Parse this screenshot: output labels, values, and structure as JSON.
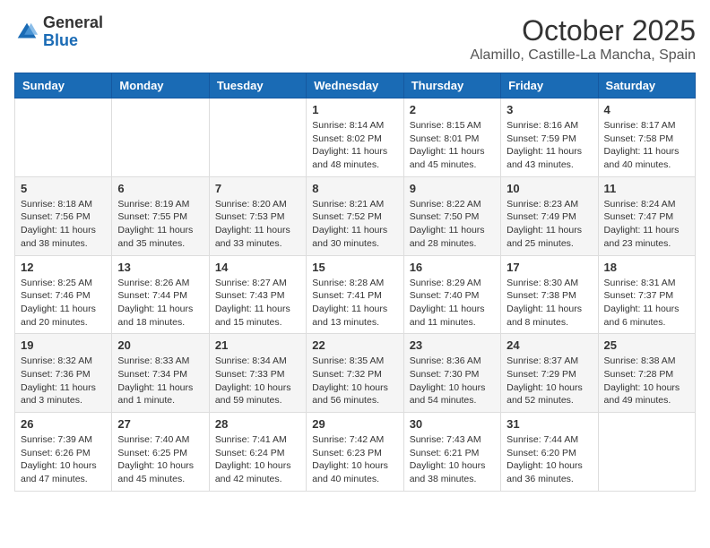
{
  "logo": {
    "general": "General",
    "blue": "Blue"
  },
  "title": "October 2025",
  "location": "Alamillo, Castille-La Mancha, Spain",
  "days_of_week": [
    "Sunday",
    "Monday",
    "Tuesday",
    "Wednesday",
    "Thursday",
    "Friday",
    "Saturday"
  ],
  "weeks": [
    [
      {
        "day": "",
        "info": ""
      },
      {
        "day": "",
        "info": ""
      },
      {
        "day": "",
        "info": ""
      },
      {
        "day": "1",
        "info": "Sunrise: 8:14 AM\nSunset: 8:02 PM\nDaylight: 11 hours and 48 minutes."
      },
      {
        "day": "2",
        "info": "Sunrise: 8:15 AM\nSunset: 8:01 PM\nDaylight: 11 hours and 45 minutes."
      },
      {
        "day": "3",
        "info": "Sunrise: 8:16 AM\nSunset: 7:59 PM\nDaylight: 11 hours and 43 minutes."
      },
      {
        "day": "4",
        "info": "Sunrise: 8:17 AM\nSunset: 7:58 PM\nDaylight: 11 hours and 40 minutes."
      }
    ],
    [
      {
        "day": "5",
        "info": "Sunrise: 8:18 AM\nSunset: 7:56 PM\nDaylight: 11 hours and 38 minutes."
      },
      {
        "day": "6",
        "info": "Sunrise: 8:19 AM\nSunset: 7:55 PM\nDaylight: 11 hours and 35 minutes."
      },
      {
        "day": "7",
        "info": "Sunrise: 8:20 AM\nSunset: 7:53 PM\nDaylight: 11 hours and 33 minutes."
      },
      {
        "day": "8",
        "info": "Sunrise: 8:21 AM\nSunset: 7:52 PM\nDaylight: 11 hours and 30 minutes."
      },
      {
        "day": "9",
        "info": "Sunrise: 8:22 AM\nSunset: 7:50 PM\nDaylight: 11 hours and 28 minutes."
      },
      {
        "day": "10",
        "info": "Sunrise: 8:23 AM\nSunset: 7:49 PM\nDaylight: 11 hours and 25 minutes."
      },
      {
        "day": "11",
        "info": "Sunrise: 8:24 AM\nSunset: 7:47 PM\nDaylight: 11 hours and 23 minutes."
      }
    ],
    [
      {
        "day": "12",
        "info": "Sunrise: 8:25 AM\nSunset: 7:46 PM\nDaylight: 11 hours and 20 minutes."
      },
      {
        "day": "13",
        "info": "Sunrise: 8:26 AM\nSunset: 7:44 PM\nDaylight: 11 hours and 18 minutes."
      },
      {
        "day": "14",
        "info": "Sunrise: 8:27 AM\nSunset: 7:43 PM\nDaylight: 11 hours and 15 minutes."
      },
      {
        "day": "15",
        "info": "Sunrise: 8:28 AM\nSunset: 7:41 PM\nDaylight: 11 hours and 13 minutes."
      },
      {
        "day": "16",
        "info": "Sunrise: 8:29 AM\nSunset: 7:40 PM\nDaylight: 11 hours and 11 minutes."
      },
      {
        "day": "17",
        "info": "Sunrise: 8:30 AM\nSunset: 7:38 PM\nDaylight: 11 hours and 8 minutes."
      },
      {
        "day": "18",
        "info": "Sunrise: 8:31 AM\nSunset: 7:37 PM\nDaylight: 11 hours and 6 minutes."
      }
    ],
    [
      {
        "day": "19",
        "info": "Sunrise: 8:32 AM\nSunset: 7:36 PM\nDaylight: 11 hours and 3 minutes."
      },
      {
        "day": "20",
        "info": "Sunrise: 8:33 AM\nSunset: 7:34 PM\nDaylight: 11 hours and 1 minute."
      },
      {
        "day": "21",
        "info": "Sunrise: 8:34 AM\nSunset: 7:33 PM\nDaylight: 10 hours and 59 minutes."
      },
      {
        "day": "22",
        "info": "Sunrise: 8:35 AM\nSunset: 7:32 PM\nDaylight: 10 hours and 56 minutes."
      },
      {
        "day": "23",
        "info": "Sunrise: 8:36 AM\nSunset: 7:30 PM\nDaylight: 10 hours and 54 minutes."
      },
      {
        "day": "24",
        "info": "Sunrise: 8:37 AM\nSunset: 7:29 PM\nDaylight: 10 hours and 52 minutes."
      },
      {
        "day": "25",
        "info": "Sunrise: 8:38 AM\nSunset: 7:28 PM\nDaylight: 10 hours and 49 minutes."
      }
    ],
    [
      {
        "day": "26",
        "info": "Sunrise: 7:39 AM\nSunset: 6:26 PM\nDaylight: 10 hours and 47 minutes."
      },
      {
        "day": "27",
        "info": "Sunrise: 7:40 AM\nSunset: 6:25 PM\nDaylight: 10 hours and 45 minutes."
      },
      {
        "day": "28",
        "info": "Sunrise: 7:41 AM\nSunset: 6:24 PM\nDaylight: 10 hours and 42 minutes."
      },
      {
        "day": "29",
        "info": "Sunrise: 7:42 AM\nSunset: 6:23 PM\nDaylight: 10 hours and 40 minutes."
      },
      {
        "day": "30",
        "info": "Sunrise: 7:43 AM\nSunset: 6:21 PM\nDaylight: 10 hours and 38 minutes."
      },
      {
        "day": "31",
        "info": "Sunrise: 7:44 AM\nSunset: 6:20 PM\nDaylight: 10 hours and 36 minutes."
      },
      {
        "day": "",
        "info": ""
      }
    ]
  ]
}
